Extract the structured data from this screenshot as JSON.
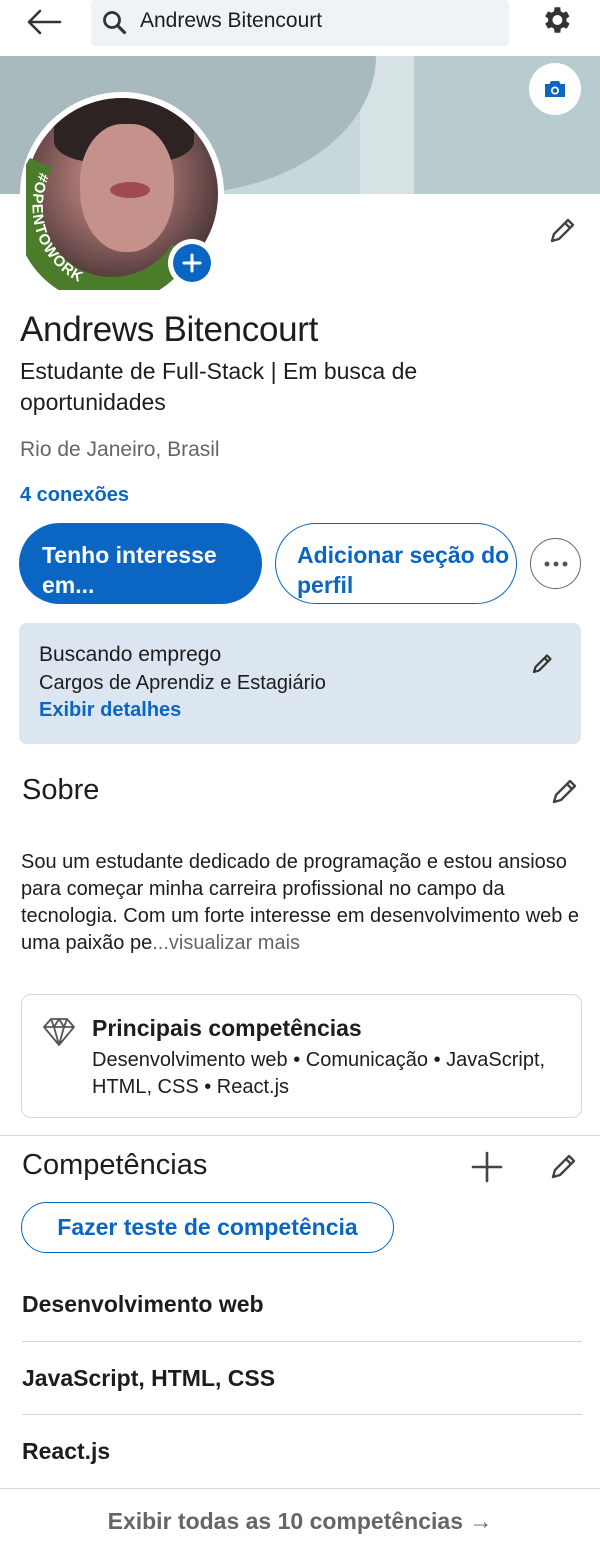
{
  "search": {
    "value": "Andrews Bitencourt"
  },
  "profile": {
    "name": "Andrews Bitencourt",
    "headline": "Estudante de Full-Stack | Em busca de oportunidades",
    "location": "Rio de Janeiro, Brasil",
    "connections": "4 conexões",
    "badge": "#OPENTOWORK"
  },
  "actions": {
    "primary": "Tenho interesse em...",
    "secondary": "Adicionar seção do perfil"
  },
  "open_to_work": {
    "title": "Buscando emprego",
    "roles": "Cargos de Aprendiz e Estagiário",
    "link": "Exibir detalhes"
  },
  "about": {
    "title": "Sobre",
    "text": "Sou um estudante dedicado de programação e estou ansioso para começar minha carreira profissional no campo da tecnologia. Com um forte interesse em desenvolvimento web e uma paixão pe",
    "more": "...visualizar mais"
  },
  "top_skills": {
    "title": "Principais competências",
    "list": "Desenvolvimento web • Comunicação • JavaScript, HTML, CSS • React.js"
  },
  "skills": {
    "title": "Competências",
    "test_button": "Fazer teste de competência",
    "items": [
      "Desenvolvimento web",
      "JavaScript, HTML, CSS",
      "React.js"
    ],
    "show_all": "Exibir todas as 10 competências →"
  },
  "colors": {
    "accent": "#0a66c2",
    "otw_green": "#4a7c2a",
    "card_bg": "#dce6f1"
  }
}
